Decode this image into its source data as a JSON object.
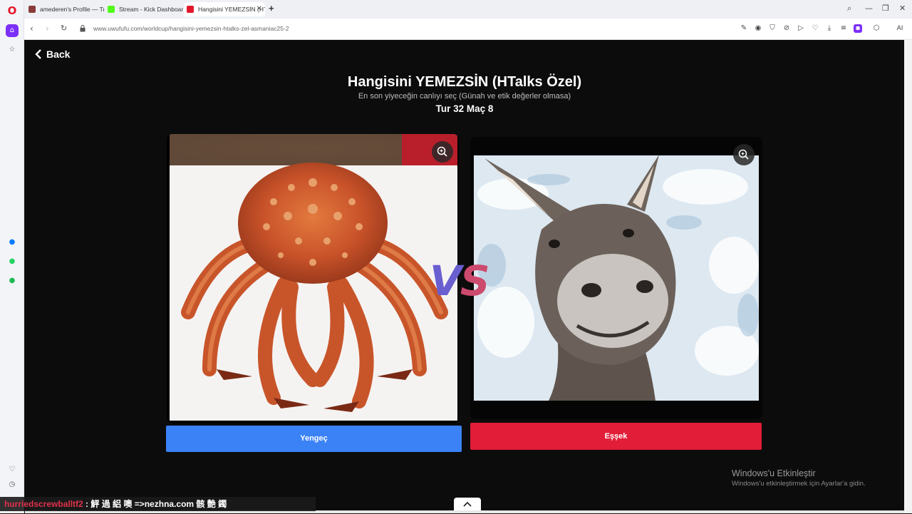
{
  "browser": {
    "tabs": [
      {
        "label": "amederen's Profile — Tru",
        "favicon_color": "#8a3b3b"
      },
      {
        "label": "Stream - Kick Dashboard",
        "favicon_color": "#53fc18"
      },
      {
        "label": "Hangisini YEMEZSİN (HTa",
        "favicon_color": "#e3172a"
      }
    ],
    "url": "www.uwufufu.com/worldcup/hangisini-yemezsin-htalks-zel-asmaniac25-2",
    "ai_label": "AI"
  },
  "page": {
    "back_label": "Back",
    "title": "Hangisini YEMEZSİN (HTalks Özel)",
    "subtitle": "En son yiyeceğin canlıyı seç (Günah ve etik değerler olmasa)",
    "round": "Tur 32 Maç 8",
    "vs": "VS",
    "left_choice": {
      "label": "Yengeç",
      "button_color": "#3b82f6",
      "image": "king-crab-photo"
    },
    "right_choice": {
      "label": "Eşşek",
      "button_color": "#e11d38",
      "image": "donkey-photo"
    }
  },
  "overlay": {
    "windows_title": "Windows'u Etkinleştir",
    "windows_sub": "Windows'u etkinleştirmek için Ayarlar'a gidin.",
    "ticker_user": "hurriedscrewballtf2",
    "ticker_msg": ": 鮃 過 絽 噢 =>nezhna.com 骸 艶 鐲"
  }
}
